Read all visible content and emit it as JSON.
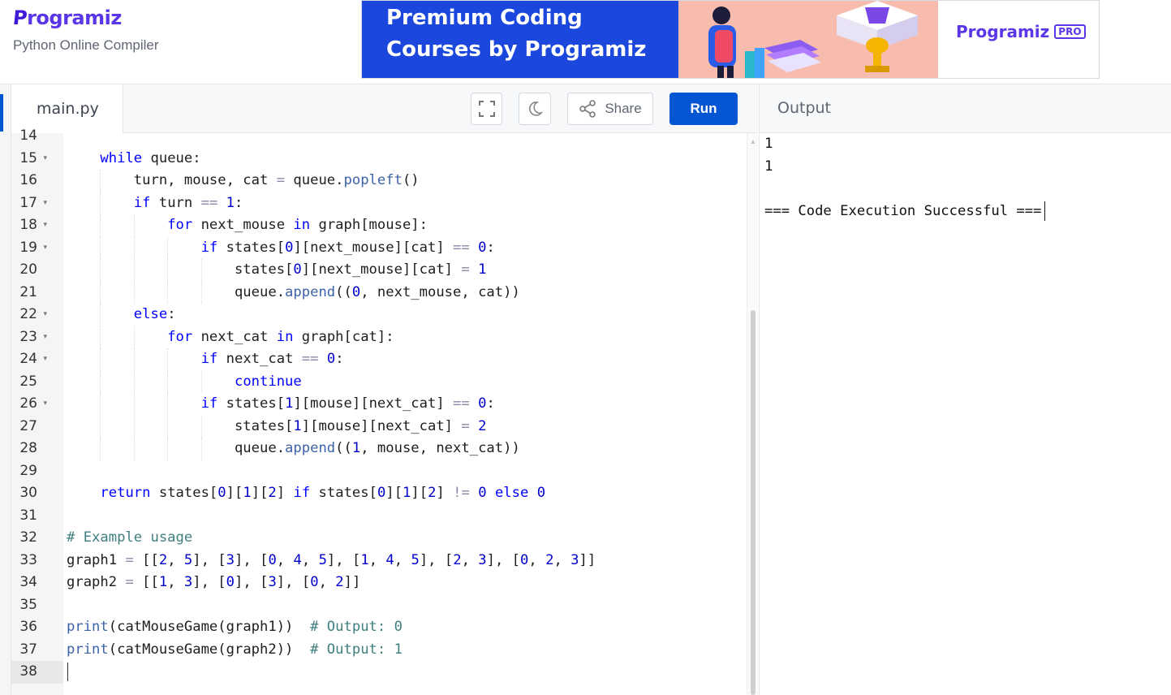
{
  "brand": {
    "logo": "rogramiz",
    "logo_first": "P",
    "subtitle": "Python Online Compiler"
  },
  "banner": {
    "line1": "Premium Coding",
    "line2": "Courses by Programiz",
    "pro_logo": "rogramiz",
    "pro_logo_first": "P",
    "pro_badge": "PRO"
  },
  "tabs": {
    "file": "main.py"
  },
  "toolbar": {
    "share_label": "Share",
    "run_label": "Run"
  },
  "output": {
    "title": "Output",
    "lines": [
      "1",
      "1",
      "",
      "=== Code Execution Successful ==="
    ]
  },
  "editor": {
    "current_line": "38",
    "line_numbers": [
      {
        "n": "14",
        "fold": false
      },
      {
        "n": "15",
        "fold": true
      },
      {
        "n": "16",
        "fold": false
      },
      {
        "n": "17",
        "fold": true
      },
      {
        "n": "18",
        "fold": true
      },
      {
        "n": "19",
        "fold": true
      },
      {
        "n": "20",
        "fold": false
      },
      {
        "n": "21",
        "fold": false
      },
      {
        "n": "22",
        "fold": true
      },
      {
        "n": "23",
        "fold": true
      },
      {
        "n": "24",
        "fold": true
      },
      {
        "n": "25",
        "fold": false
      },
      {
        "n": "26",
        "fold": true
      },
      {
        "n": "27",
        "fold": false
      },
      {
        "n": "28",
        "fold": false
      },
      {
        "n": "29",
        "fold": false
      },
      {
        "n": "30",
        "fold": false
      },
      {
        "n": "31",
        "fold": false
      },
      {
        "n": "32",
        "fold": false
      },
      {
        "n": "33",
        "fold": false
      },
      {
        "n": "34",
        "fold": false
      },
      {
        "n": "35",
        "fold": false
      },
      {
        "n": "36",
        "fold": false
      },
      {
        "n": "37",
        "fold": false
      },
      {
        "n": "38",
        "fold": false
      }
    ],
    "code_lines": [
      "",
      "    while queue:",
      "        turn, mouse, cat = queue.popleft()",
      "        if turn == 1:",
      "            for next_mouse in graph[mouse]:",
      "                if states[0][next_mouse][cat] == 0:",
      "                    states[0][next_mouse][cat] = 1",
      "                    queue.append((0, next_mouse, cat))",
      "        else:",
      "            for next_cat in graph[cat]:",
      "                if next_cat == 0:",
      "                    continue",
      "                if states[1][mouse][next_cat] == 0:",
      "                    states[1][mouse][next_cat] = 2",
      "                    queue.append((1, mouse, next_cat))",
      "",
      "    return states[0][1][2] if states[0][1][2] != 0 else 0",
      "",
      "# Example usage",
      "graph1 = [[2, 5], [3], [0, 4, 5], [1, 4, 5], [2, 3], [0, 2, 3]]",
      "graph2 = [[1, 3], [0], [3], [0, 2]]",
      "",
      "print(catMouseGame(graph1))  # Output: 0",
      "print(catMouseGame(graph2))  # Output: 1",
      ""
    ]
  }
}
